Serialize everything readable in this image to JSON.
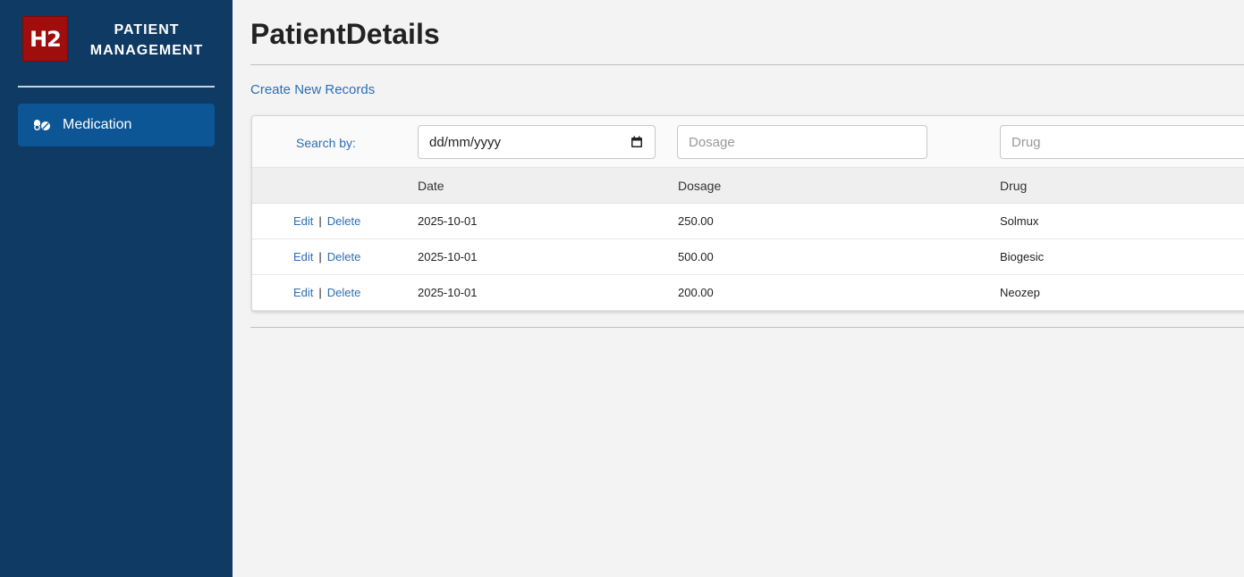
{
  "sidebar": {
    "logo_text": "H2",
    "brand_line1": "PATIENT",
    "brand_line2": "MANAGEMENT",
    "items": [
      {
        "label": "Medication",
        "icon": "pills-icon",
        "active": true
      }
    ]
  },
  "main": {
    "title": "PatientDetails",
    "create_link": "Create New Records"
  },
  "search": {
    "label": "Search by:",
    "date_placeholder": "dd/mm/yyyy",
    "dosage_placeholder": "Dosage",
    "drug_placeholder": "Drug"
  },
  "table": {
    "columns": [
      "Date",
      "Dosage",
      "Drug"
    ],
    "edit_label": "Edit",
    "delete_label": "Delete",
    "separator": "|",
    "rows": [
      {
        "date": "2025-10-01",
        "dosage": "250.00",
        "drug": "Solmux"
      },
      {
        "date": "2025-10-01",
        "dosage": "500.00",
        "drug": "Biogesic"
      },
      {
        "date": "2025-10-01",
        "dosage": "200.00",
        "drug": "Neozep"
      }
    ]
  },
  "colors": {
    "sidebar_bg": "#0e3a63",
    "nav_active_bg": "#0c5695",
    "logo_bg": "#a00d0d",
    "link": "#2c6eb5"
  }
}
